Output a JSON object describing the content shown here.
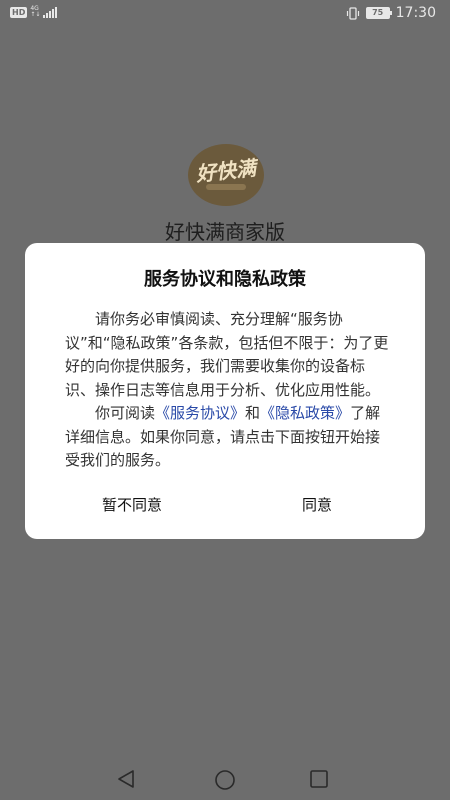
{
  "status_bar": {
    "hd": "HD",
    "network_type": "4G",
    "network_sub": "↑↓",
    "battery": "75",
    "time": "17:30"
  },
  "app": {
    "logo_text": "好快满",
    "name": "好快满商家版"
  },
  "dialog": {
    "title": "服务协议和隐私政策",
    "paragraph1": "请你务必审慎阅读、充分理解“服务协议”和“隐私政策”各条款，包括但不限于：为了更好的向你提供服务，我们需要收集你的设备标识、操作日志等信息用于分析、优化应用性能。",
    "paragraph2_prefix": "你可阅读",
    "service_link": "《服务协议》",
    "paragraph2_and": "和",
    "privacy_link": "《隐私政策》",
    "paragraph2_suffix": "了解详细信息。如果你同意，请点击下面按钮开始接受我们的服务。",
    "disagree_label": "暂不同意",
    "agree_label": "同意"
  },
  "icons": {
    "vibrate": "vibrate-icon",
    "signal": "signal-icon",
    "back": "back-triangle-icon",
    "home": "home-circle-icon",
    "recent": "recent-square-icon"
  },
  "colors": {
    "overlay": "#6d6d6d",
    "link": "#2a4aa8",
    "dialog_bg": "#ffffff"
  }
}
